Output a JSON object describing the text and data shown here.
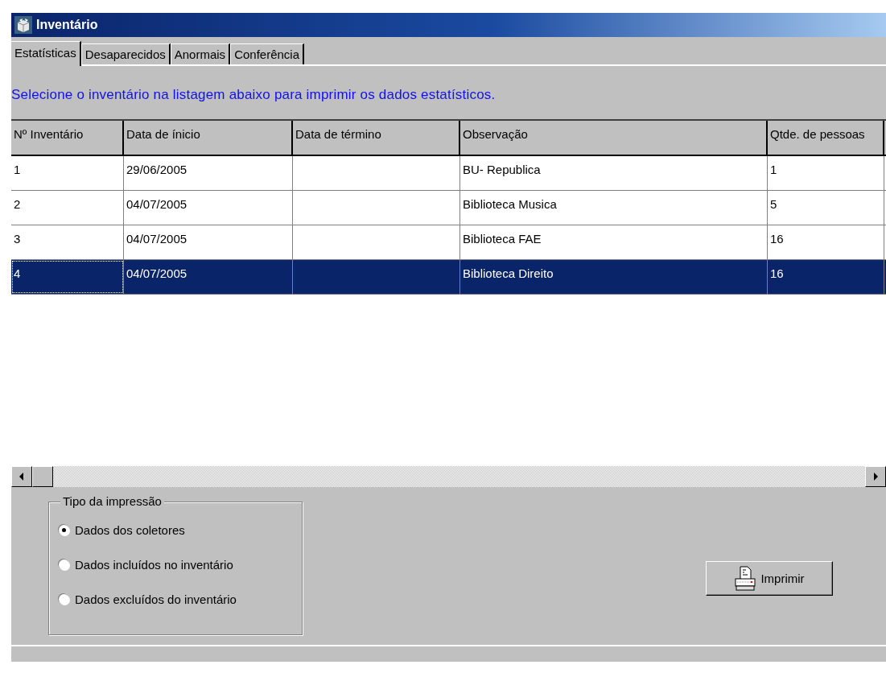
{
  "window": {
    "title": "Inventário"
  },
  "tabs": [
    {
      "label": "Estatísticas",
      "selected": true
    },
    {
      "label": "Desaparecidos",
      "selected": false
    },
    {
      "label": "Anormais",
      "selected": false
    },
    {
      "label": "Conferência",
      "selected": false
    }
  ],
  "instruction": "Selecione o inventário na listagem abaixo para imprimir os dados estatísticos.",
  "table": {
    "columns": [
      "Nº Inventário",
      "Data de ínicio",
      "Data de término",
      "Observação",
      "Qtde. de pessoas"
    ],
    "rows": [
      {
        "cells": [
          "1",
          "29/06/2005",
          "",
          "BU- Republica",
          "1"
        ],
        "selected": false
      },
      {
        "cells": [
          "2",
          "04/07/2005",
          "",
          "Biblioteca Musica",
          "5"
        ],
        "selected": false
      },
      {
        "cells": [
          "3",
          "04/07/2005",
          "",
          "Biblioteca FAE",
          "16"
        ],
        "selected": false
      },
      {
        "cells": [
          "4",
          "04/07/2005",
          "",
          "Biblioteca Direito",
          "16"
        ],
        "selected": true
      }
    ]
  },
  "print_type": {
    "legend": "Tipo da impressão",
    "options": [
      {
        "label": "Dados dos coletores",
        "selected": true
      },
      {
        "label": "Dados incluídos no inventário",
        "selected": false
      },
      {
        "label": "Dados excluídos do inventário",
        "selected": false
      }
    ]
  },
  "print_button": {
    "label": "Imprimir"
  }
}
